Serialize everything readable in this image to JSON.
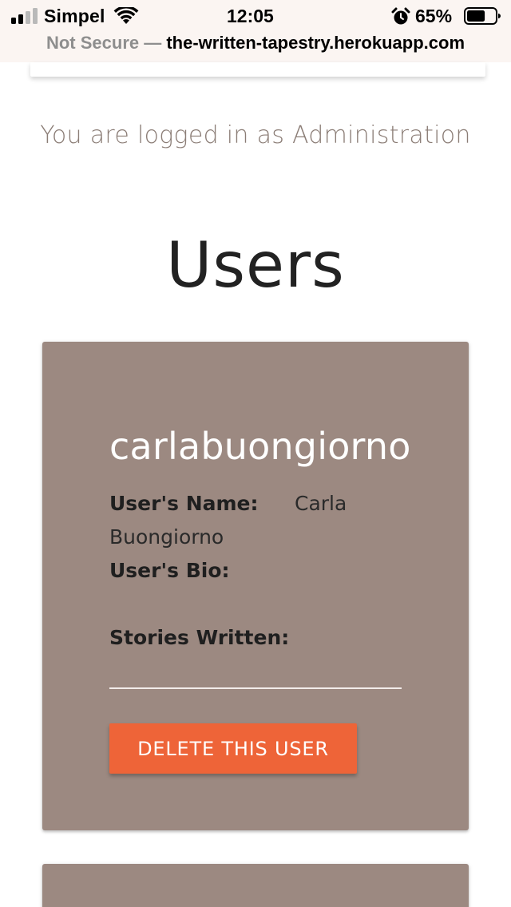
{
  "status_bar": {
    "carrier": "Simpel",
    "time": "12:05",
    "battery_percent": "65%",
    "battery_level": 0.65,
    "signal_bars_active": 2,
    "signal_bars_total": 4,
    "icons": [
      "signal-icon",
      "wifi-icon",
      "alarm-icon",
      "battery-icon"
    ]
  },
  "browser": {
    "security_label": "Not Secure —",
    "url": "the-written-tapestry.herokuapp.com"
  },
  "main": {
    "login_status": "You are logged in as Administration",
    "page_title": "Users"
  },
  "users": [
    {
      "username": "carlabuongiorno",
      "name_label": "User's Name:",
      "name_first": "Carla",
      "name_last": "Buongiorno",
      "bio_label": "User's Bio:",
      "stories_label": "Stories Written:",
      "delete_label": "DELETE THIS USER"
    }
  ],
  "colors": {
    "card": "#9c8981",
    "delete_button": "#ee6438",
    "login_text": "#8b7d76",
    "browser_chrome": "#fbf5f2"
  }
}
